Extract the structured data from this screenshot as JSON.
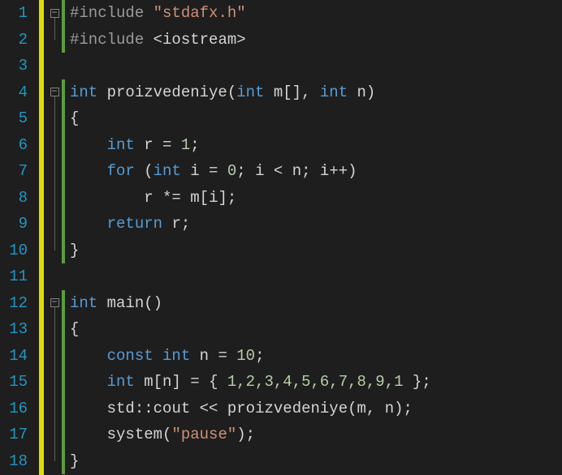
{
  "gutter": [
    "1",
    "2",
    "3",
    "4",
    "5",
    "6",
    "7",
    "8",
    "9",
    "10",
    "11",
    "12",
    "13",
    "14",
    "15",
    "16",
    "17",
    "18"
  ],
  "code": {
    "l1": {
      "preproc": "#include ",
      "str": "\"stdafx.h\""
    },
    "l2": {
      "preproc": "#include ",
      "angle": "<iostream>"
    },
    "l4": {
      "kw": "int ",
      "fn": "proizvedeniye",
      "p1": "(",
      "kw2": "int ",
      "id1": "m",
      "br": "[]",
      "c": ", ",
      "kw3": "int ",
      "id2": "n",
      "p2": ")"
    },
    "l5": {
      "b": "{"
    },
    "l6": {
      "kw": "int ",
      "id": "r ",
      "op": "= ",
      "num": "1",
      "sc": ";"
    },
    "l7": {
      "kw": "for ",
      "p1": "(",
      "kw2": "int ",
      "id": "i ",
      "op": "= ",
      "num": "0",
      "sc1": "; ",
      "id2": "i ",
      "op2": "< ",
      "id3": "n",
      "sc2": "; ",
      "id4": "i",
      "op3": "++",
      "p2": ")"
    },
    "l8": {
      "id": "r ",
      "op": "*= ",
      "id2": "m",
      "br1": "[",
      "id3": "i",
      "br2": "]",
      "sc": ";"
    },
    "l9": {
      "kw": "return ",
      "id": "r",
      "sc": ";"
    },
    "l10": {
      "b": "}"
    },
    "l12": {
      "kw": "int ",
      "fn": "main",
      "p1": "(",
      "p2": ")"
    },
    "l13": {
      "b": "{"
    },
    "l14": {
      "kw": "const int ",
      "id": "n ",
      "op": "= ",
      "num": "10",
      "sc": ";"
    },
    "l15": {
      "kw": "int ",
      "id": "m",
      "br1": "[",
      "id2": "n",
      "br2": "] ",
      "op": "= ",
      "b1": "{ ",
      "nums": "1,2,3,4,5,6,7,8,9,1 ",
      "b2": "}",
      "sc": ";"
    },
    "l16": {
      "ns": "std",
      "op1": "::",
      "id": "cout ",
      "op2": "<< ",
      "fn": "proizvedeniye",
      "p1": "(",
      "a1": "m",
      "c": ", ",
      "a2": "n",
      "p2": ")",
      "sc": ";"
    },
    "l17": {
      "fn": "system",
      "p1": "(",
      "str": "\"pause\"",
      "p2": ")",
      "sc": ";"
    },
    "l18": {
      "b": "}"
    }
  },
  "fold_minus": "−"
}
